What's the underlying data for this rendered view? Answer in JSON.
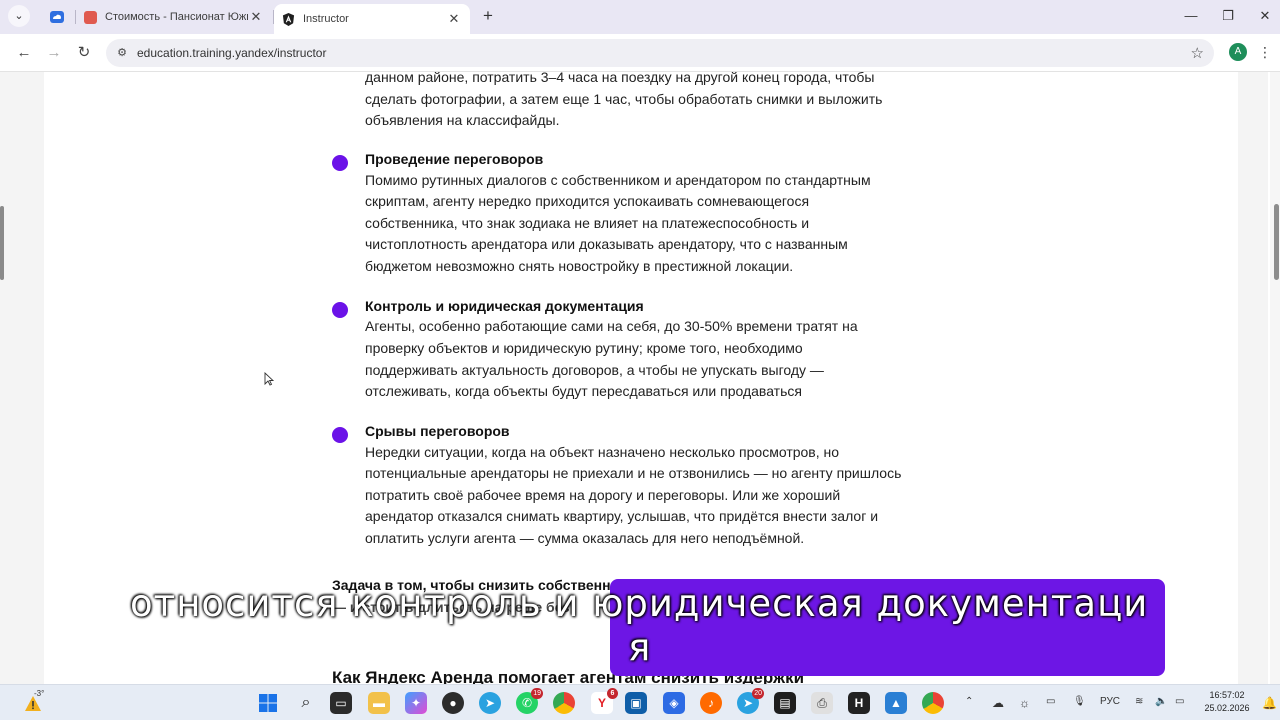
{
  "browser": {
    "tabs": [
      {
        "title": "Стоимость - Пансионат Южный",
        "favicon_color": "#e05a4f"
      },
      {
        "title": "Instructor",
        "favicon_color": "#1f1f1f",
        "active": true
      }
    ],
    "url": "education.training.yandex/instructor",
    "profile_initial": "A"
  },
  "article": {
    "intro_lines": [
      "данном районе, потратить 3–4 часа на поездку на другой конец города, чтобы",
      "сделать фотографии, а затем еще 1 час, чтобы обработать снимки и выложить",
      "объявления на классифайды."
    ],
    "items": [
      {
        "title": "Проведение переговоров",
        "lines": [
          "Помимо рутинных диалогов с собственником и арендатором по стандартным",
          "скриптам, агенту нередко приходится успокаивать сомневающегося",
          "собственника, что знак зодиака не влияет на платежеспособность и",
          "чистоплотность арендатора или доказывать арендатору, что с названным",
          "бюджетом невозможно снять новостройку в престижной локации."
        ]
      },
      {
        "title": "Контроль и юридическая документация",
        "lines": [
          "Агенты, особенно работающие сами на себя, до 30-50% времени тратят на",
          "проверку объектов и юридическую рутину; кроме того, необходимо",
          "поддерживать актуальность договоров, а чтобы не упускать выгоду —",
          "отслеживать, когда объекты будут пересдаваться или продаваться"
        ]
      },
      {
        "title": "Срывы переговоров",
        "lines": [
          "Нередки ситуации, когда на объект назначено несколько просмотров, но",
          "потенциальные арендаторы не приехали и не отзвонились — но агенту пришлось",
          "потратить своё рабочее время на дорогу и переговоры. Или же хороший",
          "арендатор отказался снимать квартиру, услышав, что придётся внести залог и",
          "оплатить услуги агента — сумма оказалась для него неподъёмной."
        ]
      }
    ],
    "task_line1": "Задача в том, чтобы снизить собственн",
    "task_line2": "— и стоит в длитьсть на реше без",
    "next_heading": "Как Яндекс Аренда помогает агентам снизить издержки"
  },
  "subtitle": {
    "line1": "относится контроль и юридическая документаци",
    "line2": "я"
  },
  "taskbar": {
    "weather_temp": "-3°",
    "language": "РУС",
    "time": "16:57:02",
    "date": "25.02.2026",
    "badges": {
      "whatsapp": "19",
      "yandex": "6",
      "telegram2": "20"
    }
  },
  "colors": {
    "accent_dot": "#6b12e8",
    "subtitle_bg": "#6d16e5"
  }
}
